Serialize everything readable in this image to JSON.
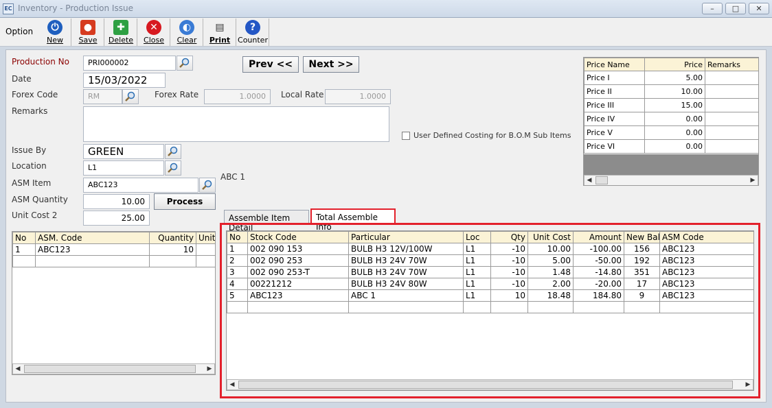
{
  "window": {
    "title": "Inventory - Production Issue",
    "app_icon": "EC"
  },
  "toolbar": {
    "option_label": "Option",
    "buttons": [
      {
        "label": "New",
        "icon": "power-icon",
        "color": "#1f5fbf"
      },
      {
        "label": "Save",
        "icon": "save-icon",
        "color": "#d63b1f"
      },
      {
        "label": "Delete",
        "icon": "delete-icon",
        "color": "#2ea043"
      },
      {
        "label": "Close",
        "icon": "close-icon",
        "color": "#d71920"
      },
      {
        "label": "Clear",
        "icon": "clear-icon",
        "color": "#3a7bd5"
      },
      {
        "label": "Print",
        "icon": "print-icon",
        "color": "#333333"
      },
      {
        "label": "Counter",
        "icon": "help-icon",
        "color": "#2457c5"
      }
    ]
  },
  "form": {
    "production_no_label": "Production No",
    "production_no": "PRI000002",
    "date_label": "Date",
    "date": "15/03/2022",
    "forex_code_label": "Forex Code",
    "forex_code": "RM",
    "forex_rate_label": "Forex Rate",
    "forex_rate": "1.0000",
    "local_rate_label": "Local Rate",
    "local_rate": "1.0000",
    "remarks_label": "Remarks",
    "remarks": "",
    "issue_by_label": "Issue By",
    "issue_by": "GREEN",
    "location_label": "Location",
    "location": "L1",
    "asm_item_label": "ASM Item",
    "asm_item": "ABC123",
    "asm_item_desc": "ABC 1",
    "asm_quantity_label": "ASM Quantity",
    "asm_quantity": "10.00",
    "unit_cost2_label": "Unit Cost 2",
    "unit_cost2": "25.00",
    "prev_label": "Prev <<",
    "next_label": "Next >>",
    "process_label": "Process",
    "user_defined_costing_label": "User Defined Costing for B.O.M Sub Items"
  },
  "price_table": {
    "headers": [
      "Price Name",
      "Price",
      "Remarks"
    ],
    "rows": [
      [
        "Price I",
        "5.00",
        ""
      ],
      [
        "Price II",
        "10.00",
        ""
      ],
      [
        "Price III",
        "15.00",
        ""
      ],
      [
        "Price IV",
        "0.00",
        ""
      ],
      [
        "Price V",
        "0.00",
        ""
      ],
      [
        "Price VI",
        "0.00",
        ""
      ]
    ]
  },
  "asm_table": {
    "headers": [
      "No",
      "ASM. Code",
      "Quantity",
      "Unit"
    ],
    "rows": [
      [
        "1",
        "ABC123",
        "10",
        ""
      ]
    ]
  },
  "tabs": [
    "Assemble Item Detail",
    "Total Assemble Info"
  ],
  "assemble_table": {
    "headers": [
      "No",
      "Stock Code",
      "Particular",
      "Loc",
      "Qty",
      "Unit Cost",
      "Amount",
      "New Bal.",
      "ASM Code"
    ],
    "rows": [
      [
        "1",
        "002 090 153",
        "BULB H3 12V/100W",
        "L1",
        "-10",
        "10.00",
        "-100.00",
        "156",
        "ABC123"
      ],
      [
        "2",
        "002 090 253",
        "BULB H3 24V 70W",
        "L1",
        "-10",
        "5.00",
        "-50.00",
        "192",
        "ABC123"
      ],
      [
        "3",
        "002 090 253-T",
        "BULB H3 24V 70W",
        "L1",
        "-10",
        "1.48",
        "-14.80",
        "351",
        "ABC123"
      ],
      [
        "4",
        "00221212",
        "BULB H3 24V 80W",
        "L1",
        "-10",
        "2.00",
        "-20.00",
        "17",
        "ABC123"
      ],
      [
        "5",
        "ABC123",
        "ABC 1",
        "L1",
        "10",
        "18.48",
        "184.80",
        "9",
        "ABC123"
      ]
    ]
  },
  "colors": {
    "highlight": "#e3202b",
    "header_bg": "#fbf3d6",
    "label_red": "#8b0000"
  }
}
